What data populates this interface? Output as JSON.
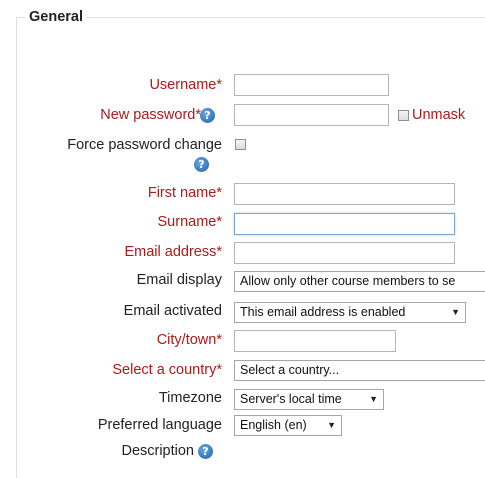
{
  "section": {
    "legend": "General"
  },
  "fields": {
    "username": {
      "label": "Username",
      "value": ""
    },
    "new_password": {
      "label": "New password",
      "value": "",
      "unmask_label": "Unmask"
    },
    "force_password_change": {
      "label": "Force password change"
    },
    "first_name": {
      "label": "First name",
      "value": ""
    },
    "surname": {
      "label": "Surname",
      "value": ""
    },
    "email_address": {
      "label": "Email address",
      "value": ""
    },
    "email_display": {
      "label": "Email display",
      "value": "Allow only other course members to se"
    },
    "email_activated": {
      "label": "Email activated",
      "value": "This email address is enabled"
    },
    "city": {
      "label": "City/town",
      "value": ""
    },
    "country": {
      "label": "Select a country",
      "value": "Select a country..."
    },
    "timezone": {
      "label": "Timezone",
      "value": "Server's local time"
    },
    "preferred_language": {
      "label": "Preferred language",
      "value": "English (en)"
    },
    "description": {
      "label": "Description"
    }
  },
  "required_marker": "*",
  "help_icon_glyph": "?",
  "colors": {
    "required_label": "#aa1b1b",
    "help_icon": "#1d5fa8",
    "focus_border": "#7ea6d3"
  }
}
